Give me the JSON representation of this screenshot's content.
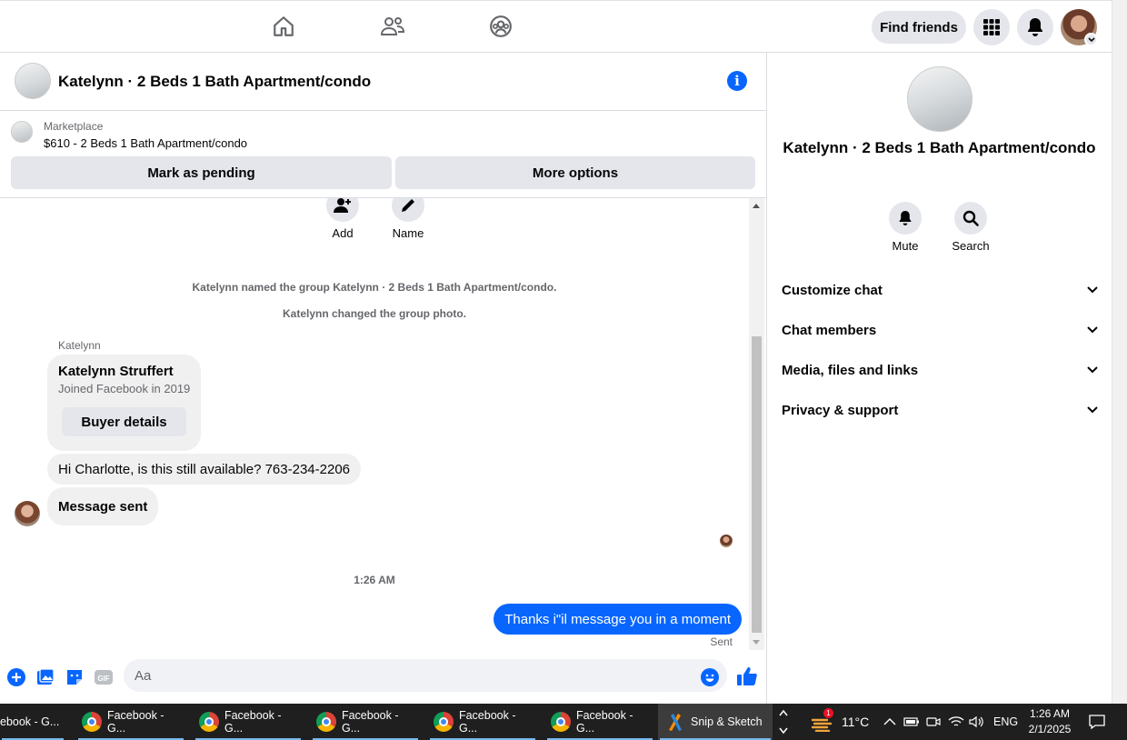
{
  "topnav": {
    "find_friends_label": "Find friends",
    "icons": [
      "home-icon",
      "friends-icon",
      "groups-icon",
      "menu-grid-icon",
      "notifications-bell-icon"
    ]
  },
  "chat": {
    "title": "Katelynn · 2 Beds 1 Bath Apartment/condo",
    "marketplace_label": "Marketplace",
    "listing": "$610 - 2 Beds 1 Bath Apartment/condo",
    "mark_pending_label": "Mark as pending",
    "more_options_label": "More options"
  },
  "messages": {
    "add_label": "Add",
    "name_label": "Name",
    "system_1": "Katelynn named the group Katelynn · 2 Beds 1 Bath Apartment/condo.",
    "system_2": "Katelynn changed the group photo.",
    "sender_name": "Katelynn",
    "card_name": "Katelynn Struffert",
    "card_sub": "Joined Facebook in 2019",
    "buyer_details_label": "Buyer details",
    "msg_1": "Hi Charlotte, is this still available? 763-234-2206",
    "msg_2": "Message sent",
    "timestamp": "1:26 AM",
    "outgoing": "Thanks i\"il message you in a moment",
    "status": "Sent"
  },
  "composer": {
    "placeholder": "Aa",
    "icons": [
      "plus-icon",
      "photo-icon",
      "sticker-icon",
      "gif-icon",
      "emoji-icon",
      "thumbs-up-icon"
    ]
  },
  "rpanel": {
    "title": "Katelynn · 2 Beds 1 Bath Apartment/condo",
    "mute_label": "Mute",
    "search_label": "Search",
    "rows": [
      "Customize chat",
      "Chat members",
      "Media, files and links",
      "Privacy & support"
    ]
  },
  "taskbar": {
    "items": [
      "ebook - G...",
      "Facebook - G...",
      "Facebook - G...",
      "Facebook - G...",
      "Facebook - G...",
      "Facebook - G...",
      "Snip & Sketch"
    ],
    "weather_badge": "1",
    "temperature": "11°C",
    "language": "ENG",
    "time": "1:26 AM",
    "date": "2/1/2025"
  },
  "colors": {
    "accent": "#0866ff",
    "bubble_in": "#f0f0f0",
    "button_bg": "#e4e6eb",
    "muted_text": "#65676b"
  }
}
